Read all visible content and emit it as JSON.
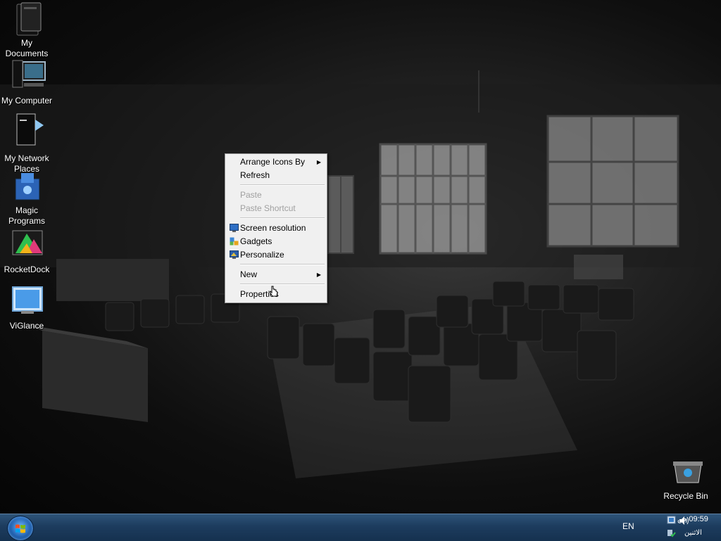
{
  "desktop": {
    "icons": [
      {
        "label_line1": "My",
        "label_line2": "Documents",
        "icon": "my-documents-icon"
      },
      {
        "label_line1": "My Computer",
        "label_line2": "",
        "icon": "computer-icon"
      },
      {
        "label_line1": "My Network",
        "label_line2": "Places",
        "icon": "network-places-icon"
      },
      {
        "label_line1": "Magic",
        "label_line2": "Programs",
        "icon": "magic-programs-icon"
      },
      {
        "label_line1": "RocketDock",
        "label_line2": "",
        "icon": "rocketdock-icon"
      },
      {
        "label_line1": "ViGlance",
        "label_line2": "",
        "icon": "viglance-icon"
      }
    ],
    "recycle_bin": {
      "label": "Recycle Bin",
      "icon": "recycle-bin-icon"
    }
  },
  "context_menu": {
    "items": [
      {
        "label": "Arrange Icons By",
        "enabled": true,
        "submenu": true
      },
      {
        "label": "Refresh",
        "enabled": true,
        "submenu": false
      },
      {
        "label": "Paste",
        "enabled": false,
        "submenu": false
      },
      {
        "label": "Paste Shortcut",
        "enabled": false,
        "submenu": false
      },
      {
        "label": "Screen resolution",
        "enabled": true,
        "submenu": false,
        "icon": "screen-resolution-icon"
      },
      {
        "label": "Gadgets",
        "enabled": true,
        "submenu": false,
        "icon": "gadgets-icon"
      },
      {
        "label": "Personalize",
        "enabled": true,
        "submenu": false,
        "icon": "personalize-icon"
      },
      {
        "label": "New",
        "enabled": true,
        "submenu": true
      },
      {
        "label": "Properties",
        "enabled": true,
        "submenu": false
      }
    ],
    "submenu_arrow": "▶"
  },
  "taskbar": {
    "start_icon": "windows-start-orb-icon",
    "language": "EN",
    "clock_time": "09:59 ص",
    "clock_day": "الاثنين"
  },
  "colors": {
    "taskbar": "#1d3c5e",
    "menu_bg": "#f0f0f0",
    "menu_disabled": "#a0a0a0"
  }
}
